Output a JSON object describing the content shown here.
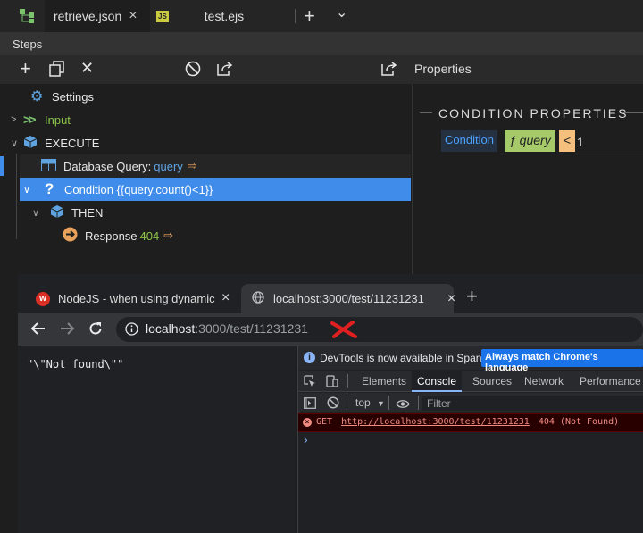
{
  "ide": {
    "tabs": [
      {
        "label": "retrieve.json",
        "close": "×"
      },
      {
        "label": "test.ejs",
        "badge": "JS"
      }
    ],
    "new_tab": "+",
    "chevron": "⌄",
    "steps_title": "Steps",
    "properties_label": "Properties",
    "tree": [
      {
        "label": "Settings"
      },
      {
        "label": "Input"
      },
      {
        "label": "EXECUTE"
      },
      {
        "label": "Database Query: ",
        "keyword": "query"
      },
      {
        "label": "Condition {{query.count()<1}}"
      },
      {
        "label": "THEN"
      },
      {
        "label": "Response ",
        "status": "404"
      }
    ],
    "condition_title": "CONDITION PROPERTIES",
    "condition_label": "Condition",
    "chip_func": "ƒ query",
    "chip_op": "<",
    "chip_value": "1"
  },
  "browser": {
    "tabs": [
      {
        "label": "NodeJS - when using dynamic UR"
      },
      {
        "label": "localhost:3000/test/11231231",
        "close": "×"
      }
    ],
    "new_tab": "+",
    "url_host": "localhost",
    "url_path": ":3000/test/11231231",
    "page_text": "\"\\\"Not found\\\"\"",
    "devtools": {
      "info_text": "DevTools is now available in Spanish!",
      "match_button": "Always match Chrome's language",
      "tabs": [
        "Elements",
        "Console",
        "Sources",
        "Network",
        "Performance"
      ],
      "context": "top",
      "filter_placeholder": "Filter",
      "error_method": "GET",
      "error_url": "http://localhost:3000/test/11231231",
      "error_status": "404 (Not Found)",
      "prompt": "›"
    }
  },
  "colors": {
    "selection": "#3f8cea",
    "accent_orange": "#e8a15a",
    "accent_green": "#8bc34a",
    "devtools_blue": "#1a73e8"
  }
}
